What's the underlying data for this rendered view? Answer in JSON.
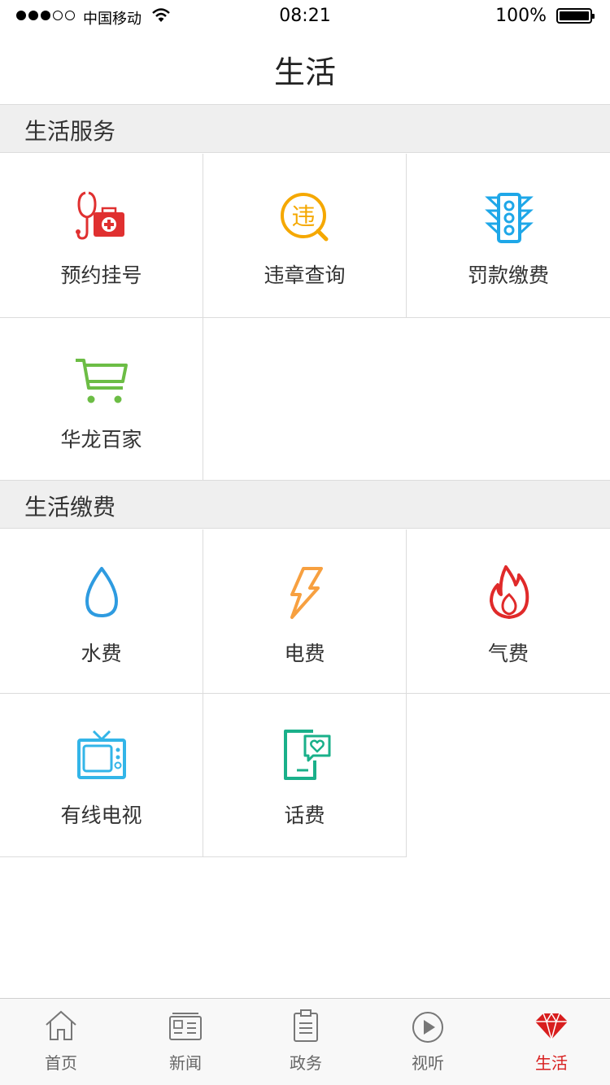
{
  "status_bar": {
    "carrier": "中国移动",
    "time": "08:21",
    "battery": "100%"
  },
  "header": {
    "title": "生活"
  },
  "sections": [
    {
      "title": "生活服务",
      "items": [
        {
          "label": "预约挂号",
          "icon": "stethoscope-medkit-icon",
          "color": "#e03030"
        },
        {
          "label": "违章查询",
          "icon": "violation-search-icon",
          "color": "#f5a800"
        },
        {
          "label": "罚款缴费",
          "icon": "traffic-light-icon",
          "color": "#1ea7e8"
        },
        {
          "label": "华龙百家",
          "icon": "shopping-cart-icon",
          "color": "#6cbd45"
        }
      ]
    },
    {
      "title": "生活缴费",
      "items": [
        {
          "label": "水费",
          "icon": "water-drop-icon",
          "color": "#2e9be0"
        },
        {
          "label": "电费",
          "icon": "lightning-icon",
          "color": "#f7a040"
        },
        {
          "label": "气费",
          "icon": "flame-icon",
          "color": "#e02a2a"
        },
        {
          "label": "有线电视",
          "icon": "tv-icon",
          "color": "#33b5e8"
        },
        {
          "label": "话费",
          "icon": "phone-bill-heart-icon",
          "color": "#1ab08a"
        }
      ]
    }
  ],
  "icon_text": {
    "violation": "违"
  },
  "tab_bar": {
    "active_color": "#d81e1e",
    "tabs": [
      {
        "label": "首页",
        "icon": "home-icon"
      },
      {
        "label": "新闻",
        "icon": "news-icon"
      },
      {
        "label": "政务",
        "icon": "clipboard-icon"
      },
      {
        "label": "视听",
        "icon": "play-icon"
      },
      {
        "label": "生活",
        "icon": "diamond-icon",
        "active": true
      }
    ]
  }
}
